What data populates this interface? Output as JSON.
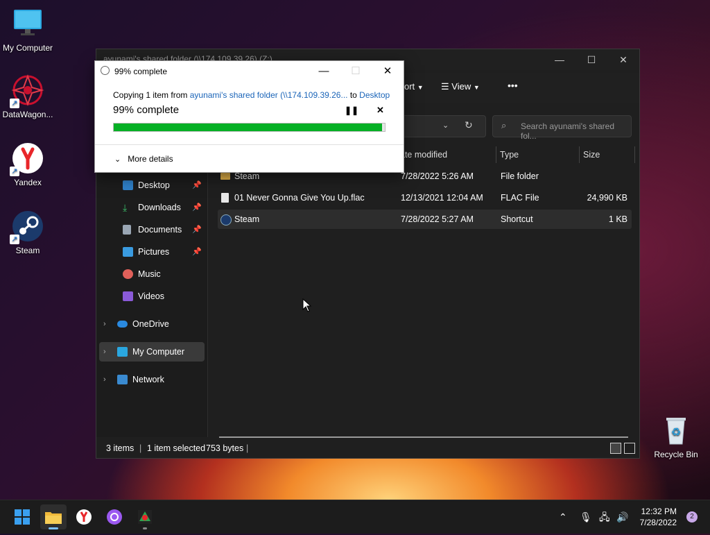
{
  "desktop": {
    "icons": [
      {
        "label": "My Computer"
      },
      {
        "label": "DataWagon..."
      },
      {
        "label": "Yandex"
      },
      {
        "label": "Steam"
      },
      {
        "label": "Recycle Bin"
      }
    ]
  },
  "explorer": {
    "title": "ayunami's shared folder (\\\\174.109.39.26) (Z:)",
    "toolbar": {
      "sort_label": "ort",
      "view_label": "View",
      "more": "•••"
    },
    "search_placeholder": "Search ayunami's shared fol...",
    "columns": {
      "date": "ate modified",
      "type": "Type",
      "size": "Size"
    },
    "nav": {
      "desktop": "Desktop",
      "downloads": "Downloads",
      "documents": "Documents",
      "pictures": "Pictures",
      "music": "Music",
      "videos": "Videos",
      "onedrive": "OneDrive",
      "mycomputer": "My Computer",
      "network": "Network"
    },
    "rows": [
      {
        "name": "Steam",
        "date": "7/28/2022 5:26 AM",
        "type": "File folder",
        "size": ""
      },
      {
        "name": "01 Never Gonna Give You Up.flac",
        "date": "12/13/2021 12:04 AM",
        "type": "FLAC File",
        "size": "24,990 KB"
      },
      {
        "name": "Steam",
        "date": "7/28/2022 5:27 AM",
        "type": "Shortcut",
        "size": "1 KB"
      }
    ],
    "status": {
      "items": "3 items",
      "selected": "1 item selected",
      "bytes": "753 bytes"
    }
  },
  "dialog": {
    "title": "99% complete",
    "copying_prefix": "Copying 1 item from ",
    "source": "ayunami's shared folder (\\\\174.109.39.26...",
    "to": " to ",
    "dest": "Desktop",
    "percent_label": "99% complete",
    "progress": 0.99,
    "more_details": "More details"
  },
  "taskbar": {
    "time": "12:32 PM",
    "date": "7/28/2022",
    "notifications": "2"
  },
  "colors": {
    "progress": "#06b025",
    "link": "#1a64b8",
    "accent": "#0078d4"
  }
}
